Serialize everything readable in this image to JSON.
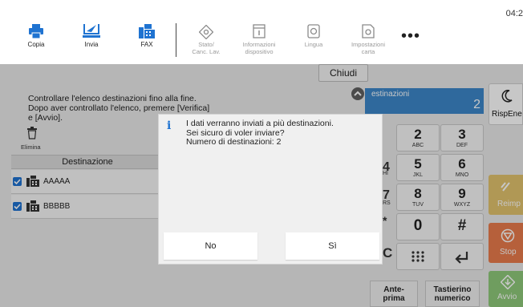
{
  "clock": "04:2",
  "topbar": {
    "items": [
      {
        "label": "Copia"
      },
      {
        "label": "Invia"
      },
      {
        "label": "FAX"
      },
      {
        "label": "Stato/\nCanc. Lav."
      },
      {
        "label": "Informazioni\ndispositivo"
      },
      {
        "label": "Lingua"
      },
      {
        "label": "Impostazioni\ncarta"
      }
    ],
    "more": "•••"
  },
  "main": {
    "close_label": "Chiudi",
    "instructions": [
      "Controllare l'elenco destinazioni fino alla fine.",
      "Dopo aver controllato l'elenco, premere [Verifica]",
      "e [Avvio]."
    ],
    "delete_label": "Elimina",
    "dest_header": "Destinazione",
    "destinations": [
      {
        "name": "AAAAA"
      },
      {
        "name": "BBBBB"
      }
    ]
  },
  "right_panel": {
    "dest_label": "estinazioni",
    "dest_count": "2",
    "keys": [
      {
        "digit": "2",
        "letters": "ABC"
      },
      {
        "digit": "3",
        "letters": "DEF"
      },
      {
        "digit": "5",
        "letters": "JKL"
      },
      {
        "digit": "6",
        "letters": "MNO"
      },
      {
        "digit": "8",
        "letters": "TUV"
      },
      {
        "digit": "9",
        "letters": "WXYZ"
      },
      {
        "digit": "0",
        "letters": ""
      },
      {
        "digit": "#",
        "letters": ""
      }
    ],
    "partial_letters": [
      "4",
      "HI",
      "7",
      "RS",
      "*",
      "C"
    ],
    "prev_label": [
      "Ante-",
      "prima"
    ],
    "numpad_label": [
      "Tastierino",
      "numerico"
    ]
  },
  "side_buttons": {
    "sleep": "RispEne",
    "reset": "Reimp",
    "stop": "Stop",
    "start": "Avvio"
  },
  "dialog": {
    "icon": "i",
    "lines": [
      "I dati verranno inviati a più destinazioni.",
      "Sei sicuro di voler inviare?",
      "Numero di destinazioni: 2"
    ],
    "no_label": "No",
    "yes_label": "Sì"
  },
  "colors": {
    "accent_blue": "#1f73d1",
    "dest_panel": "#3d87c9",
    "reset": "#e2c36d",
    "stop": "#e97c4c",
    "start": "#8fc97a"
  }
}
